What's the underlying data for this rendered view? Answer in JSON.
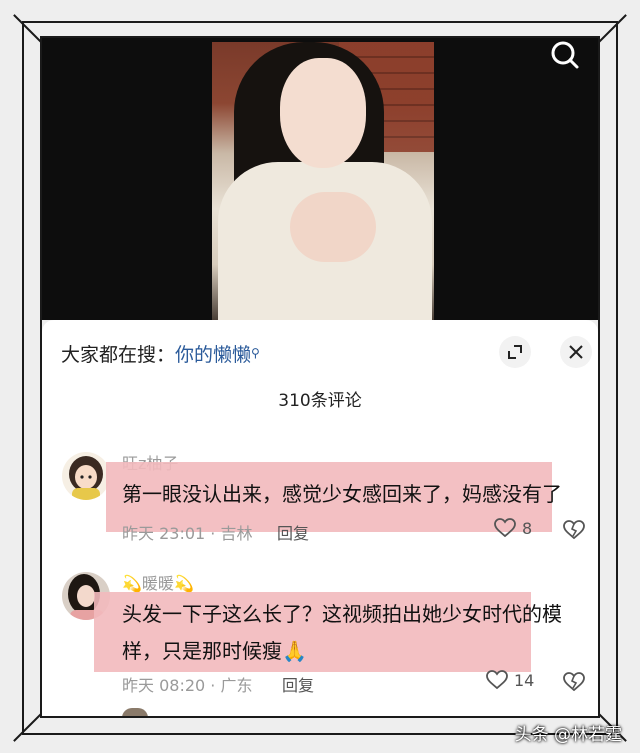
{
  "search_hint": {
    "prefix": "大家都在搜：",
    "keyword": "你的懒懒"
  },
  "comment_count": "310条评论",
  "comments": [
    {
      "username": "旺z柚子",
      "text_lines": [
        "第一眼没认出来，感觉少女感回来了，妈感没有了"
      ],
      "time": "昨天 23:01 · 吉林",
      "reply_label": "回复",
      "likes": "8"
    },
    {
      "username": "暖暖",
      "username_decor": "💫",
      "text_lines": [
        "头发一下子这么长了？这视频拍出她少女时代的模",
        "样，只是那时候瘦🙏"
      ],
      "time": "昨天 08:20 · 广东",
      "reply_label": "回复",
      "likes": "14"
    }
  ],
  "watermark": "头条 @林若霆",
  "icons": {
    "search": "search-icon",
    "expand": "expand-icon",
    "close": "close-icon",
    "like": "heart-icon",
    "dislike": "broken-heart-icon"
  },
  "colors": {
    "highlight": "#f2b9bd",
    "keyword": "#2a5a9a"
  }
}
